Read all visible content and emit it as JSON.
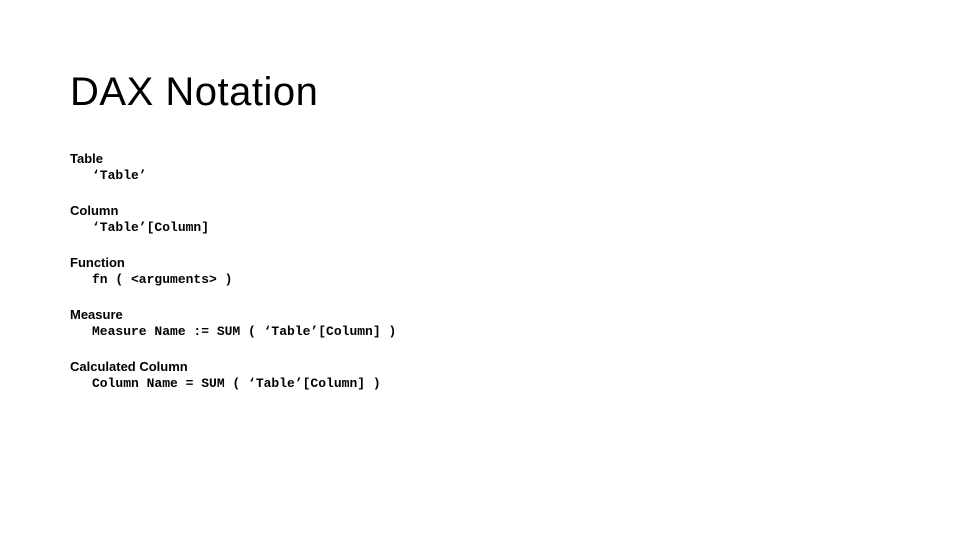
{
  "title": "DAX Notation",
  "sections": [
    {
      "label": "Table",
      "code": "‘Table’"
    },
    {
      "label": "Column",
      "code": "‘Table’[Column]"
    },
    {
      "label": "Function",
      "code": "fn ( <arguments> )"
    },
    {
      "label": "Measure",
      "code": "Measure Name := SUM ( ‘Table’[Column] )"
    },
    {
      "label": "Calculated Column",
      "code": "Column Name = SUM ( ‘Table’[Column] )"
    }
  ]
}
